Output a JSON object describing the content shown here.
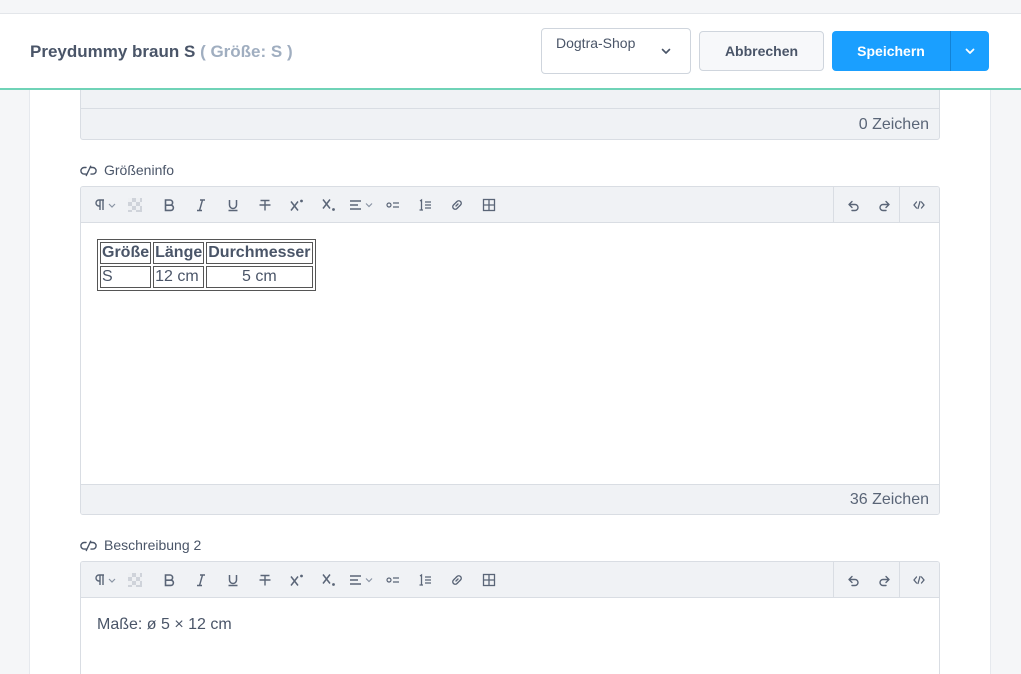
{
  "header": {
    "title": "Preydummy braun S",
    "subtitle": "( Größe: S )",
    "shop_select": "Dogtra-Shop",
    "cancel_label": "Abbrechen",
    "save_label": "Speichern"
  },
  "fields": {
    "previous_counter": "0 Zeichen",
    "groesseninfo": {
      "label": "Größeninfo",
      "table": {
        "headers": [
          "Größe",
          "Länge",
          "Durchmesser"
        ],
        "rows": [
          [
            "S",
            "12 cm",
            "5 cm"
          ]
        ]
      },
      "counter": "36 Zeichen"
    },
    "beschreibung2": {
      "label": "Beschreibung 2",
      "content": "Maße: ø 5 × 12 cm"
    }
  },
  "toolbar": {
    "buttons": [
      "paragraph-format",
      "background-color",
      "bold",
      "italic",
      "underline",
      "strikethrough",
      "superscript",
      "subscript",
      "align",
      "unordered-list",
      "ordered-list",
      "link",
      "table",
      "undo",
      "redo",
      "code-view"
    ]
  },
  "colors": {
    "accent": "#1a9fff",
    "header_underline": "#6fd3b7"
  }
}
